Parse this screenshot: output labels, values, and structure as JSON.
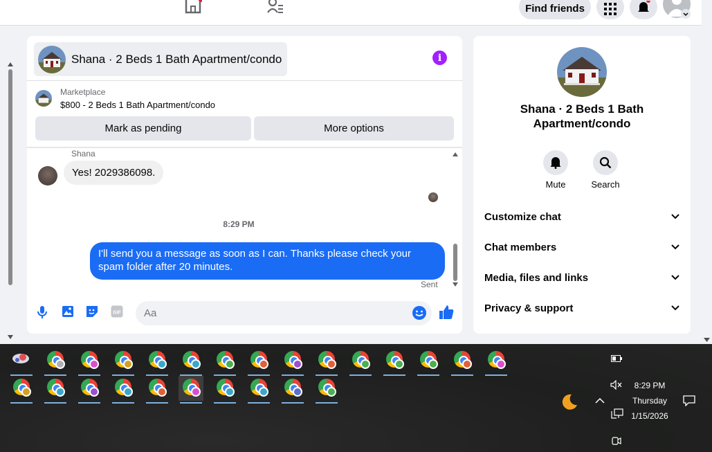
{
  "topbar": {
    "find_friends": "Find friends",
    "icons": [
      "home-icon",
      "friends-icon",
      "menu-grid-icon",
      "notifications-icon",
      "account-avatar"
    ]
  },
  "chat": {
    "title": "Shana · 2 Beds 1 Bath Apartment/condo",
    "marketplace_label": "Marketplace",
    "listing": "$800 - 2 Beds 1 Bath Apartment/condo",
    "mark_pending": "Mark as pending",
    "more_options": "More options",
    "sender_name": "Shana",
    "incoming_message": "Yes! 2029386098.",
    "timestamp": "8:29 PM",
    "outgoing_message": "I'll send you a message as soon as I can. Thanks please check your spam folder after 20 minutes.",
    "sent_status": "Sent",
    "input_placeholder": "Aa",
    "accent_color": "#1a6cf5",
    "info_color": "#a120ff"
  },
  "details": {
    "title": "Shana · 2 Beds 1 Bath Apartment/condo",
    "mute": "Mute",
    "search": "Search",
    "rows": [
      "Customize chat",
      "Chat members",
      "Media, files and links",
      "Privacy & support"
    ]
  },
  "taskbar": {
    "time": "8:29 PM",
    "day": "Thursday",
    "date": "1/15/2026",
    "row1_profile_colors": [
      "#b0b0b0",
      "#b0b0b0",
      "#d94fd0",
      "#d4a020",
      "#3aa7c9",
      "#3aa7c9",
      "#4caf50",
      "#e0603a",
      "#9c4fd0",
      "#e0603a",
      "#4caf50",
      "#4caf50",
      "#4caf50",
      "#e0603a",
      "#d94fd0"
    ],
    "row2_profile_colors": [
      "#d4a020",
      "#3aa7c9",
      "#9c4fd0",
      "#3aa7c9",
      "#e0603a",
      "#d94fd0",
      "#3aa7c9",
      "#3aa7c9",
      "#5a6fd0",
      "#4caf50"
    ]
  }
}
